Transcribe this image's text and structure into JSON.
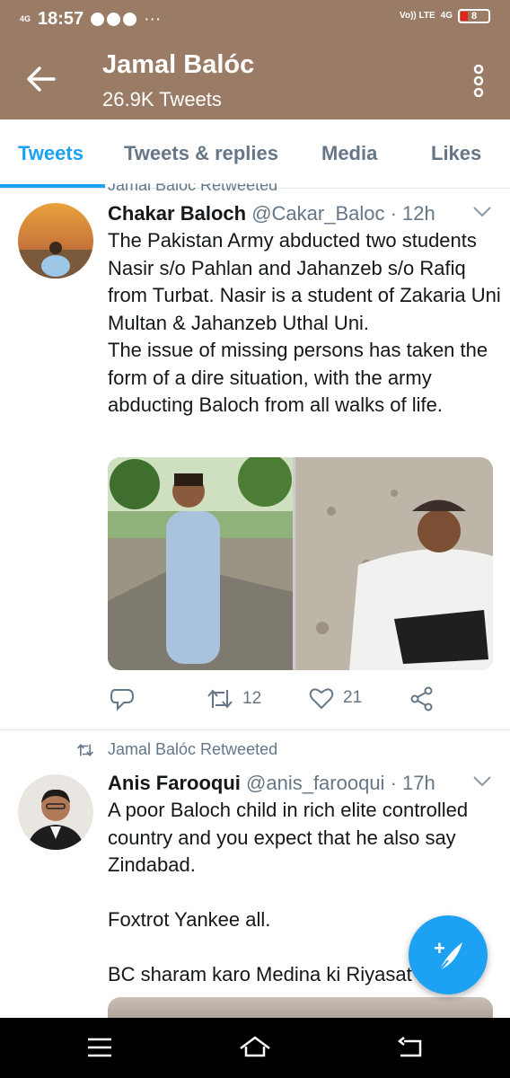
{
  "status_bar": {
    "network_left": "4G",
    "time": "18:57",
    "more": "···",
    "volte": "Vo)) LTE",
    "network_right": "4G",
    "battery": "8"
  },
  "header": {
    "title": "Jamal Balóc",
    "subtitle": "26.9K Tweets",
    "bg_color": "#9a7b66"
  },
  "tabs": [
    {
      "label": "Tweets",
      "active": true
    },
    {
      "label": "Tweets & replies",
      "active": false
    },
    {
      "label": "Media",
      "active": false
    },
    {
      "label": "Likes",
      "active": false
    }
  ],
  "accent_color": "#1da1f2",
  "cut_retweet_label": "Jamal Balóc Retweeted",
  "tweets": [
    {
      "author": "Chakar Baloch",
      "handle": "@Cakar_Baloc",
      "time": "· 12h",
      "text": "The Pakistan Army abducted two students Nasir s/o Pahlan and Jahanzeb s/o Rafiq from Turbat. Nasir is a student of Zakaria Uni Multan & Jahanzeb Uthal Uni.\nThe issue of missing persons has taken the form of a dire situation, with the army abducting Baloch from all walks of life.",
      "retweets": "12",
      "likes": "21",
      "icons": [
        "reply-icon",
        "retweet-icon",
        "heart-icon",
        "share-icon"
      ]
    },
    {
      "retweeted_by": "Jamal Balóc Retweeted",
      "author": "Anis Farooqui",
      "handle": "@anis_farooqui",
      "time": "· 17h",
      "text": "A poor Baloch child in  rich elite controlled country and you expect that he also say Zindabad.\n\nFoxtrot Yankee all.\n\nBC sharam karo Medina ki Riyasat"
    }
  ],
  "fab": {
    "icon": "compose-tweet-icon",
    "symbol": "+"
  },
  "nav": {
    "icons": [
      "menu-icon",
      "home-icon",
      "back-icon"
    ]
  }
}
